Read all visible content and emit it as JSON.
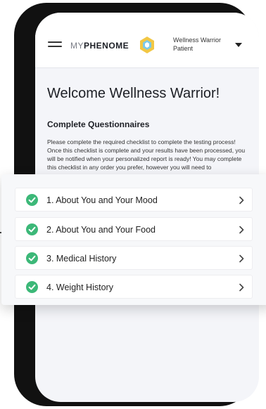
{
  "header": {
    "logo_prefix": "MY",
    "logo_main": "PHENOME",
    "user_name": "Wellness Warrior",
    "user_role": "Patient"
  },
  "main": {
    "welcome": "Welcome Wellness Warrior!",
    "section_title": "Complete Questionnaires",
    "description": "Please complete the required checklist to complete the testing process! Once this checklist is complete and your results have been processed, you will be notified when your personalized report is ready! You may complete this checklist in any order you prefer, however you will need to"
  },
  "checklist": [
    {
      "label": "1. About You and Your Mood",
      "completed": true
    },
    {
      "label": "2. About You and Your Food",
      "completed": true
    },
    {
      "label": "3. Medical History",
      "completed": true
    },
    {
      "label": "4. Weight History",
      "completed": true
    }
  ],
  "colors": {
    "check_green": "#3cb878",
    "logo_accent": "#f2c744"
  }
}
